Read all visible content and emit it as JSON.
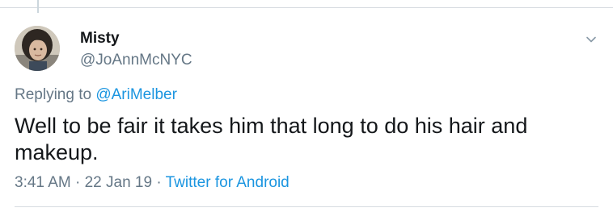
{
  "tweet": {
    "author": {
      "display_name": "Misty",
      "handle": "@JoAnnMcNYC",
      "avatar_icon": "user-photo-avatar"
    },
    "replying_to": {
      "prefix": "Replying to",
      "mention": "@AriMelber"
    },
    "text": "Well to be fair it takes him that long to do his hair and makeup.",
    "time": "3:41 AM",
    "separator": "·",
    "date": "22 Jan 19",
    "source": "Twitter for Android",
    "menu_icon": "chevron-down-icon"
  },
  "colors": {
    "primary_text": "#14171a",
    "secondary_text": "#657786",
    "link": "#1b95e0",
    "divider": "#d7dbe0"
  }
}
